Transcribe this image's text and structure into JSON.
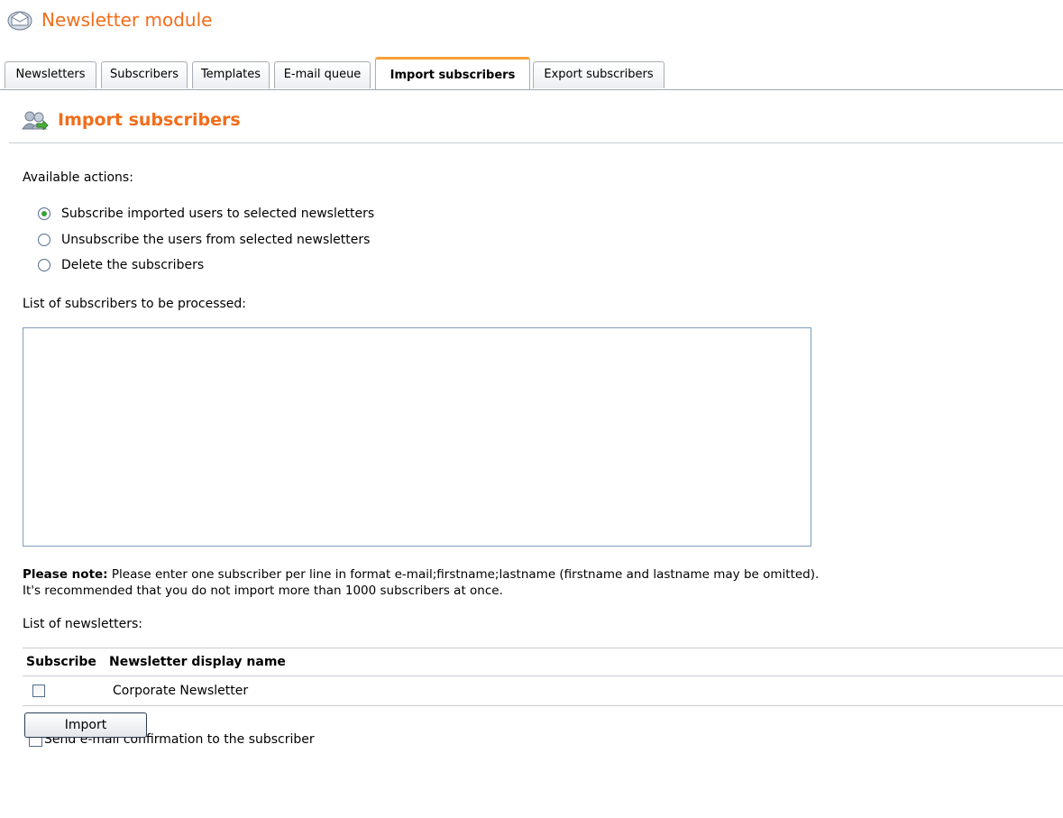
{
  "module": {
    "title": "Newsletter module",
    "icon": "newsletter-envelope-icon"
  },
  "tabs": [
    {
      "label": "Newsletters",
      "active": false
    },
    {
      "label": "Subscribers",
      "active": false
    },
    {
      "label": "Templates",
      "active": false
    },
    {
      "label": "E-mail queue",
      "active": false
    },
    {
      "label": "Import subscribers",
      "active": true
    },
    {
      "label": "Export subscribers",
      "active": false
    }
  ],
  "section": {
    "title": "Import subscribers",
    "icon": "import-users-icon"
  },
  "actions": {
    "label": "Available actions:",
    "options": [
      {
        "label": "Subscribe imported users to selected newsletters",
        "checked": true
      },
      {
        "label": "Unsubscribe the users from selected newsletters",
        "checked": false
      },
      {
        "label": "Delete the subscribers",
        "checked": false
      }
    ]
  },
  "subscribers_list": {
    "label": "List of subscribers to be processed:",
    "value": ""
  },
  "note": {
    "bold": "Please note:",
    "line1": " Please enter one subscriber per line in format e-mail;firstname;lastname (firstname and lastname may be omitted).",
    "line2": "It's recommended that you do not import more than 1000 subscribers at once."
  },
  "newsletters": {
    "label": "List of newsletters:",
    "columns": [
      "Subscribe",
      "Newsletter display name"
    ],
    "rows": [
      {
        "checked": false,
        "name": "Corporate Newsletter"
      }
    ]
  },
  "confirmation": {
    "label": "Send e-mail confirmation to the subscriber",
    "checked": false
  },
  "import_button": {
    "label": "Import"
  },
  "colors": {
    "accent": "#f26d1a",
    "active_tab_top": "#f7a03a",
    "radio_dot": "#3aa035"
  }
}
